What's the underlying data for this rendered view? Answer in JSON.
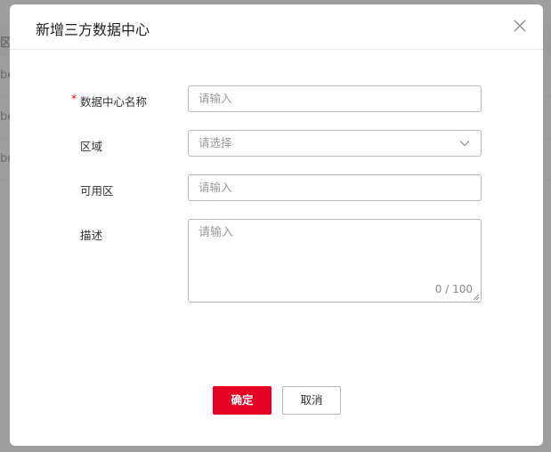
{
  "background": {
    "header_label": "区",
    "rows": [
      "be",
      "be",
      "be"
    ]
  },
  "modal": {
    "title": "新增三方数据中心",
    "close_icon": "close-icon",
    "required_mark": "*",
    "fields": [
      {
        "label": "数据中心名称",
        "placeholder": "请输入",
        "required": true
      },
      {
        "label": "区域",
        "placeholder": "请选择",
        "type": "select"
      },
      {
        "label": "可用区",
        "placeholder": "请输入"
      },
      {
        "label": "描述",
        "placeholder": "请输入",
        "type": "textarea",
        "counter": "0 / 100"
      }
    ],
    "buttons": {
      "confirm": "确定",
      "cancel": "取消"
    },
    "colors": {
      "primary": "#e60023",
      "required": "#e60012"
    }
  }
}
